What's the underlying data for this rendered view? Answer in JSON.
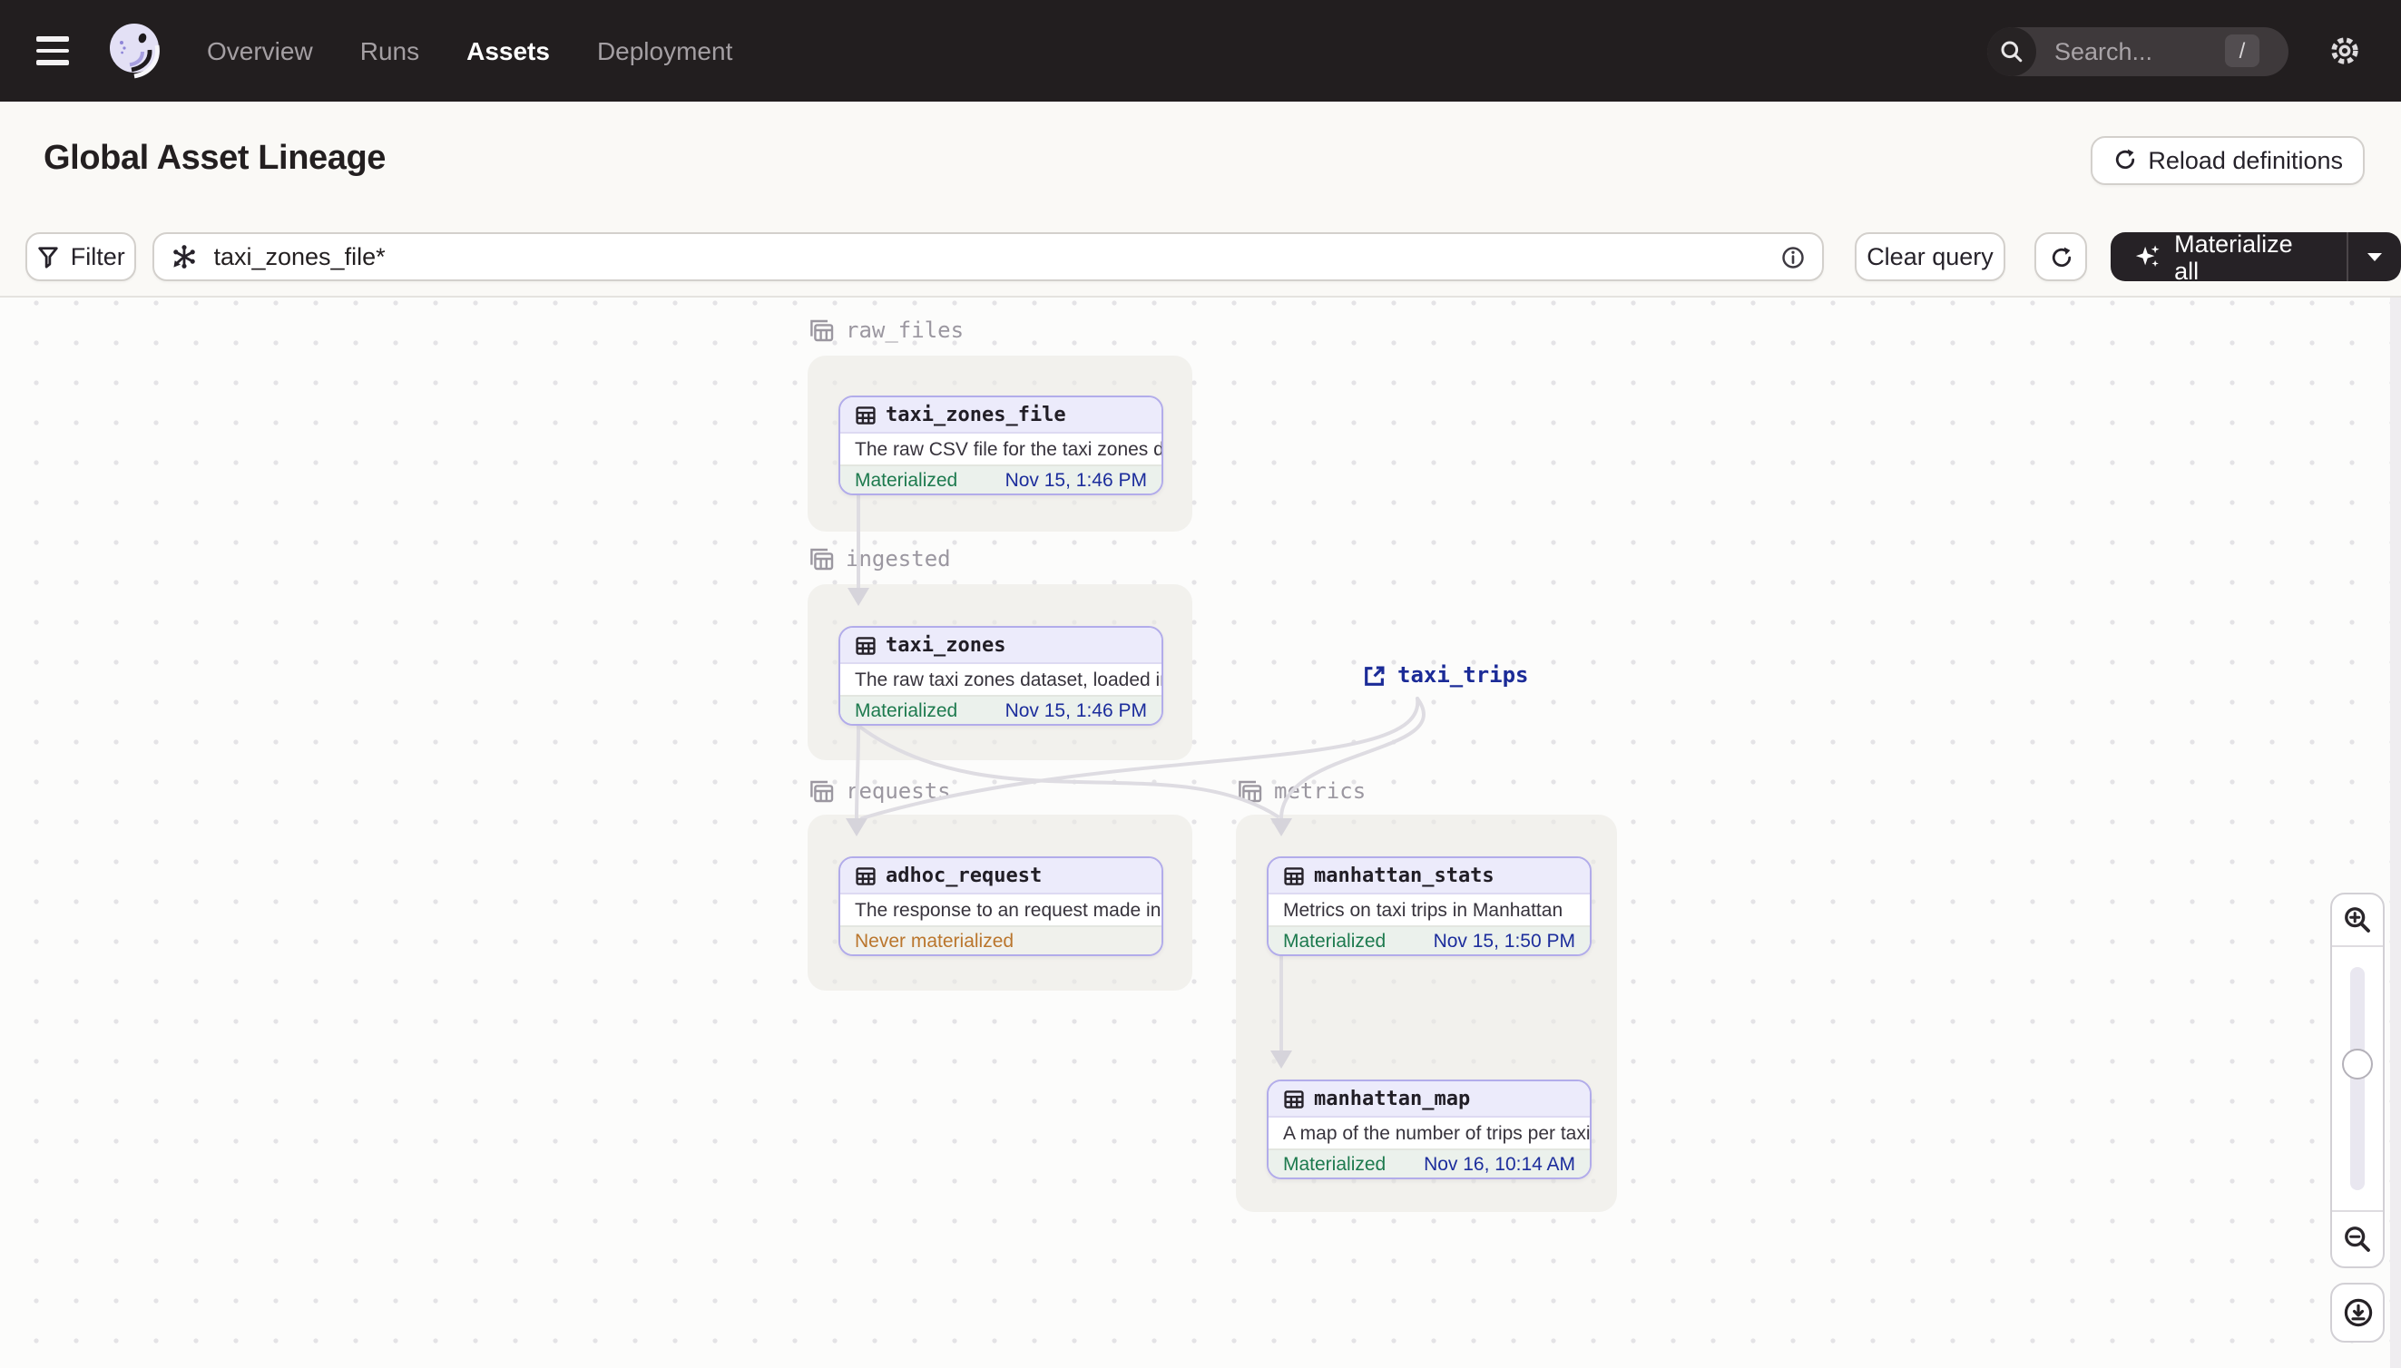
{
  "nav": {
    "menu_items": [
      {
        "label": "Overview"
      },
      {
        "label": "Runs"
      },
      {
        "label": "Assets"
      },
      {
        "label": "Deployment"
      }
    ],
    "active_item": "Assets",
    "search": {
      "placeholder": "Search...",
      "shortcut": "/"
    }
  },
  "header": {
    "title": "Global Asset Lineage",
    "reload_button_label": "Reload definitions"
  },
  "toolbar": {
    "filter_button_label": "Filter",
    "query_value": "taxi_zones_file*",
    "clear_query_label": "Clear query",
    "materialize_button_label": "Materialize all"
  },
  "graph": {
    "groups": [
      {
        "name": "raw_files"
      },
      {
        "name": "ingested"
      },
      {
        "name": "requests"
      },
      {
        "name": "metrics"
      }
    ],
    "nodes": [
      {
        "id": "taxi_zones_file",
        "group": "raw_files",
        "description": "The raw CSV file for the taxi zones dat...",
        "status": "Materialized",
        "timestamp": "Nov 15, 1:46 PM"
      },
      {
        "id": "taxi_zones",
        "group": "ingested",
        "description": "The raw taxi zones dataset, loaded int...",
        "status": "Materialized",
        "timestamp": "Nov 15, 1:46 PM"
      },
      {
        "id": "adhoc_request",
        "group": "requests",
        "description": "The response to an request made in th...",
        "status": "Never materialized",
        "timestamp": ""
      },
      {
        "id": "manhattan_stats",
        "group": "metrics",
        "description": "Metrics on taxi trips in Manhattan",
        "status": "Materialized",
        "timestamp": "Nov 15, 1:50 PM"
      },
      {
        "id": "manhattan_map",
        "group": "metrics",
        "description": "A map of the number of trips per taxi z...",
        "status": "Materialized",
        "timestamp": "Nov 16, 10:14 AM"
      }
    ],
    "external_assets": [
      {
        "name": "taxi_trips"
      }
    ]
  },
  "colors": {
    "nav_bg": "#221E1F",
    "node_border_purple": "#B2ACEA",
    "node_header_purple": "#ECEBFB",
    "materialized_green": "#1D7A4E",
    "never_materialized_orange": "#BA762D",
    "timestamp_blue": "#1C2D9C",
    "external_asset_blue": "#1B2B97",
    "materialize_button_bg": "#262226"
  }
}
